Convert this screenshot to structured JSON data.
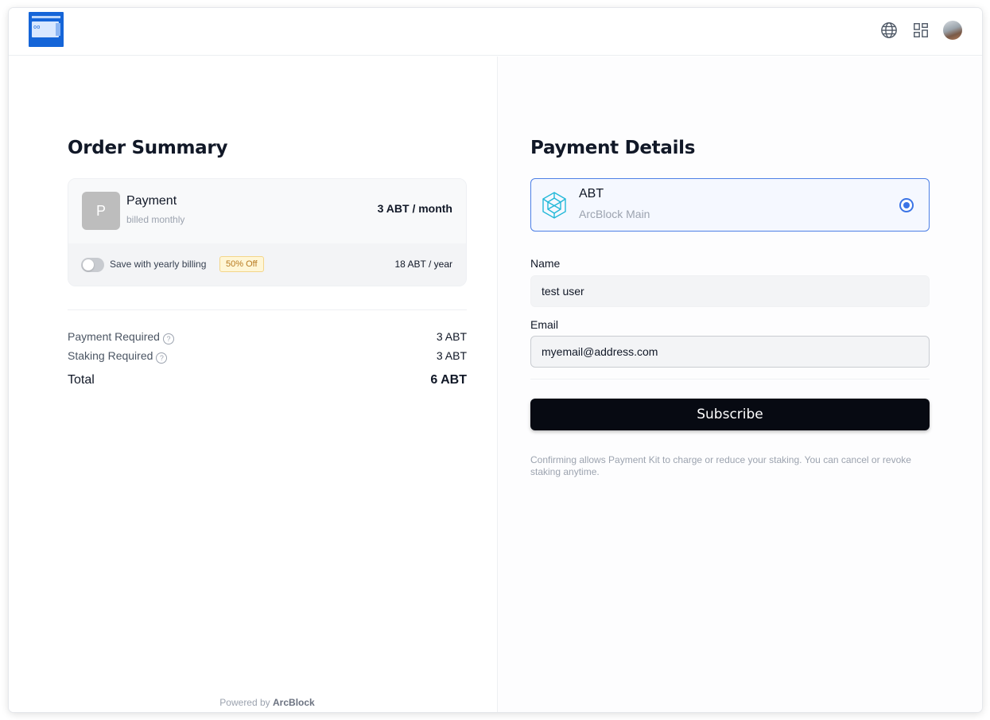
{
  "header": {
    "icons": [
      "globe-icon",
      "apps-grid-icon",
      "user-avatar"
    ]
  },
  "order_summary": {
    "title": "Order Summary",
    "product": {
      "initial": "P",
      "name": "Payment",
      "billing": "billed monthly",
      "price": "3 ABT / month"
    },
    "yearly": {
      "label": "Save with yearly billing",
      "badge": "50% Off",
      "price": "18 ABT / year",
      "enabled": false
    },
    "lines": [
      {
        "label": "Payment Required",
        "value": "3 ABT"
      },
      {
        "label": "Staking Required",
        "value": "3 ABT"
      }
    ],
    "total": {
      "label": "Total",
      "value": "6 ABT"
    },
    "powered_prefix": "Powered by",
    "powered_brand": "ArcBlock"
  },
  "payment_details": {
    "title": "Payment Details",
    "method": {
      "name": "ABT",
      "network": "ArcBlock Main",
      "selected": true
    },
    "name_label": "Name",
    "name_value": "test user",
    "email_label": "Email",
    "email_value": "myemail@address.com",
    "subscribe_label": "Subscribe",
    "disclaimer": "Confirming allows Payment Kit to charge or reduce your staking. You can cancel or revoke staking anytime."
  },
  "colors": {
    "accent": "#3b74e6",
    "button_bg": "#070a12",
    "badge_bg": "#fff6d6",
    "badge_text": "#b7791f",
    "logo_blue": "#1565d8"
  }
}
